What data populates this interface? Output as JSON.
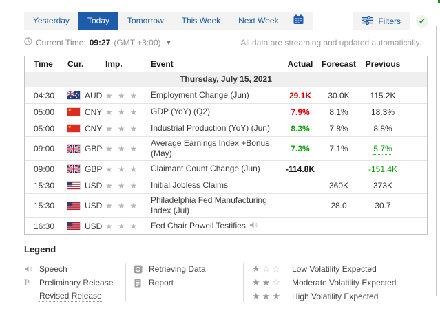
{
  "colors": {
    "tab_active_bg": "#1e5baa",
    "link_blue": "#155aa2",
    "actual_red": "#d40000",
    "actual_green": "#0a9c0a",
    "check_green": "#2e9e2e"
  },
  "tabs": [
    {
      "label": "Yesterday",
      "active": false
    },
    {
      "label": "Today",
      "active": true
    },
    {
      "label": "Tomorrow",
      "active": false
    },
    {
      "label": "This Week",
      "active": false
    },
    {
      "label": "Next Week",
      "active": false
    }
  ],
  "filters": {
    "label": "Filters"
  },
  "status": {
    "current_time_label": "Current Time:",
    "time": "09:27",
    "timezone": "(GMT +3:00)",
    "streaming_note": "All data are streaming and updated automatically."
  },
  "table": {
    "headers": [
      "Time",
      "Cur.",
      "Imp.",
      "Event",
      "Actual",
      "Forecast",
      "Previous"
    ],
    "date_header": "Thursday, July 15, 2021",
    "rows": [
      {
        "time": "04:30",
        "currency": "AUD",
        "importance": 3,
        "event": "Employment Change (Jun)",
        "actual": "29.1K",
        "actual_class": "red",
        "forecast": "30.0K",
        "previous": "115.2K",
        "previous_class": "",
        "speech_icon": false
      },
      {
        "time": "05:00",
        "currency": "CNY",
        "importance": 3,
        "event": "GDP (YoY) (Q2)",
        "actual": "7.9%",
        "actual_class": "red",
        "forecast": "8.1%",
        "previous": "18.3%",
        "previous_class": "",
        "speech_icon": false
      },
      {
        "time": "05:00",
        "currency": "CNY",
        "importance": 3,
        "event": "Industrial Production (YoY) (Jun)",
        "actual": "8.3%",
        "actual_class": "green",
        "forecast": "7.8%",
        "previous": "8.8%",
        "previous_class": "",
        "speech_icon": false
      },
      {
        "time": "09:00",
        "currency": "GBP",
        "importance": 3,
        "event": "Average Earnings Index +Bonus (May)",
        "actual": "7.3%",
        "actual_class": "green",
        "forecast": "7.1%",
        "previous": "5.7%",
        "previous_class": "revised-green",
        "speech_icon": false
      },
      {
        "time": "09:00",
        "currency": "GBP",
        "importance": 3,
        "event": "Claimant Count Change (Jun)",
        "actual": "-114.8K",
        "actual_class": "dark",
        "forecast": "",
        "previous": "-151.4K",
        "previous_class": "revised-green",
        "speech_icon": false
      },
      {
        "time": "15:30",
        "currency": "USD",
        "importance": 3,
        "event": "Initial Jobless Claims",
        "actual": "",
        "actual_class": "",
        "forecast": "360K",
        "previous": "373K",
        "previous_class": "",
        "speech_icon": false
      },
      {
        "time": "15:30",
        "currency": "USD",
        "importance": 3,
        "event": "Philadelphia Fed Manufacturing Index (Jul)",
        "actual": "",
        "actual_class": "",
        "forecast": "28.0",
        "previous": "30.7",
        "previous_class": "",
        "speech_icon": false
      },
      {
        "time": "16:30",
        "currency": "USD",
        "importance": 3,
        "event": "Fed Chair Powell Testifies",
        "actual": "",
        "actual_class": "",
        "forecast": "",
        "previous": "",
        "previous_class": "",
        "speech_icon": true
      }
    ]
  },
  "legend": {
    "title": "Legend",
    "col1": [
      {
        "icon": "speech-icon",
        "label": "Speech",
        "underlined": false
      },
      {
        "icon": "preliminary-release-icon",
        "label": "Preliminary Release",
        "underlined": false
      },
      {
        "icon": "",
        "label": "Revised Release",
        "underlined": true
      }
    ],
    "col2": [
      {
        "icon": "retrieving-data-icon",
        "label": "Retrieving Data"
      },
      {
        "icon": "report-icon",
        "label": "Report"
      }
    ],
    "col3": [
      {
        "stars": 1,
        "label": "Low Volatility Expected"
      },
      {
        "stars": 2,
        "label": "Moderate Volatility Expected"
      },
      {
        "stars": 3,
        "label": "High Volatility Expected"
      }
    ]
  }
}
